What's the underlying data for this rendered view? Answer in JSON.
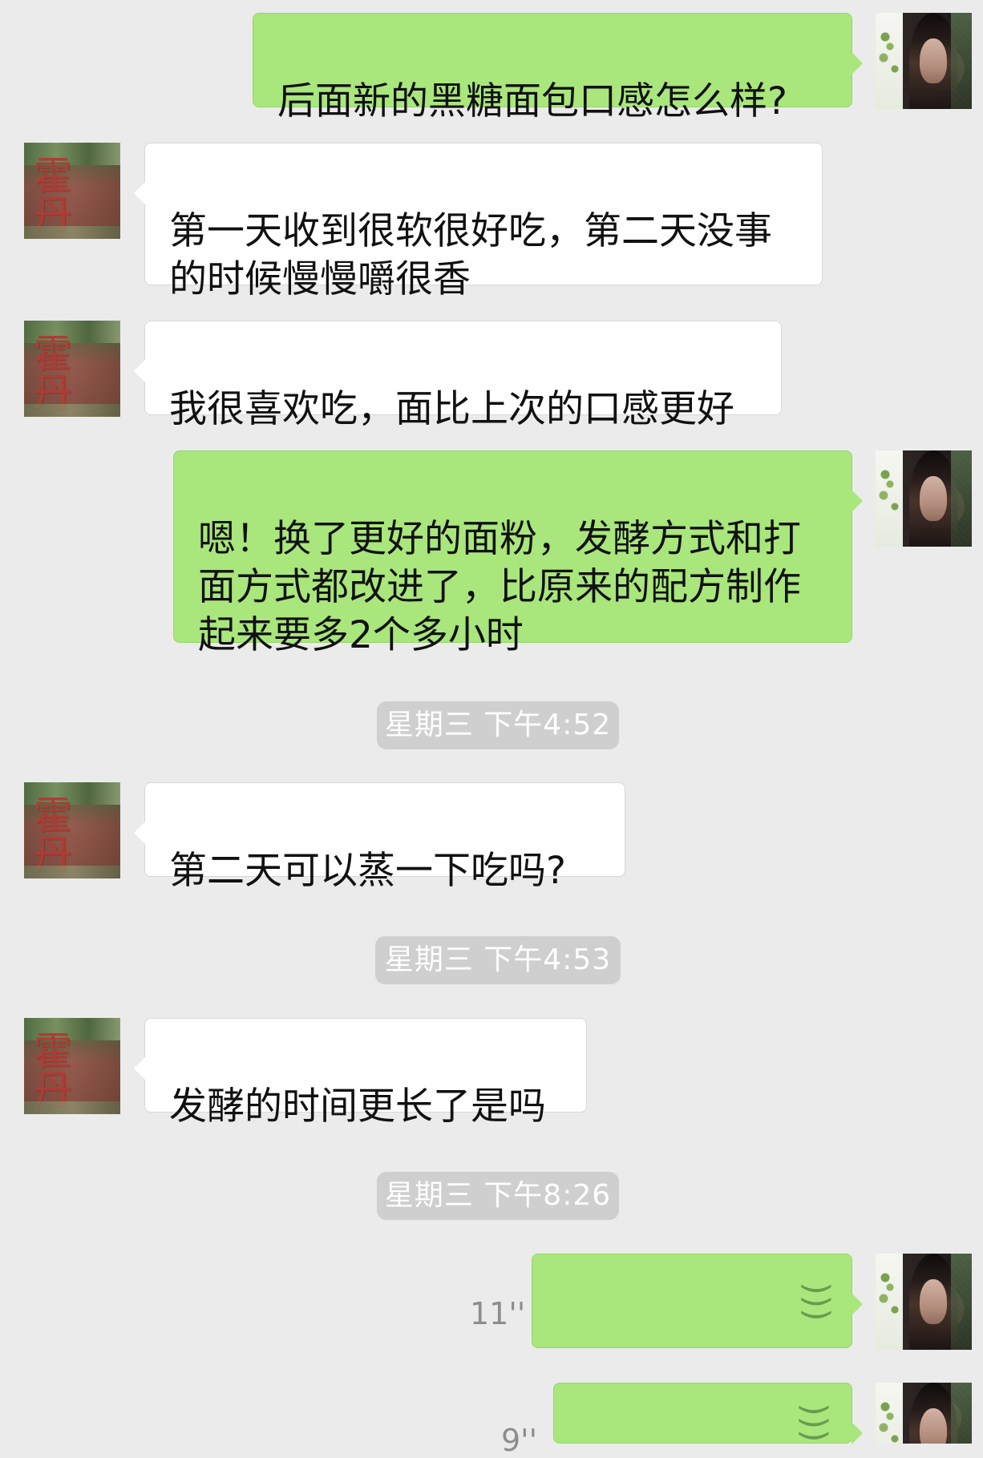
{
  "messages": [
    {
      "side": "right",
      "text": "后面新的黑糖面包口感怎么样?"
    },
    {
      "side": "left",
      "text": "第一天收到很软很好吃，第二天没事\n的时候慢慢嚼很香"
    },
    {
      "side": "left",
      "text": "我很喜欢吃，面比上次的口感更好"
    },
    {
      "side": "right",
      "text": "嗯！换了更好的面粉，发酵方式和打\n面方式都改进了，比原来的配方制作\n起来要多2个多小时"
    },
    {
      "timestamp": "星期三 下午4:52"
    },
    {
      "side": "left",
      "text": "第二天可以蒸一下吃吗?"
    },
    {
      "timestamp": "星期三 下午4:53"
    },
    {
      "side": "left",
      "text": "发酵的时间更长了是吗"
    },
    {
      "timestamp": "星期三 下午8:26"
    },
    {
      "side": "right",
      "voice_duration": "11''"
    },
    {
      "side": "right",
      "voice_duration": "9''"
    }
  ],
  "avatars": {
    "left_text": "霍丹"
  },
  "icons": {
    "voice": "voice-wave-icon"
  }
}
